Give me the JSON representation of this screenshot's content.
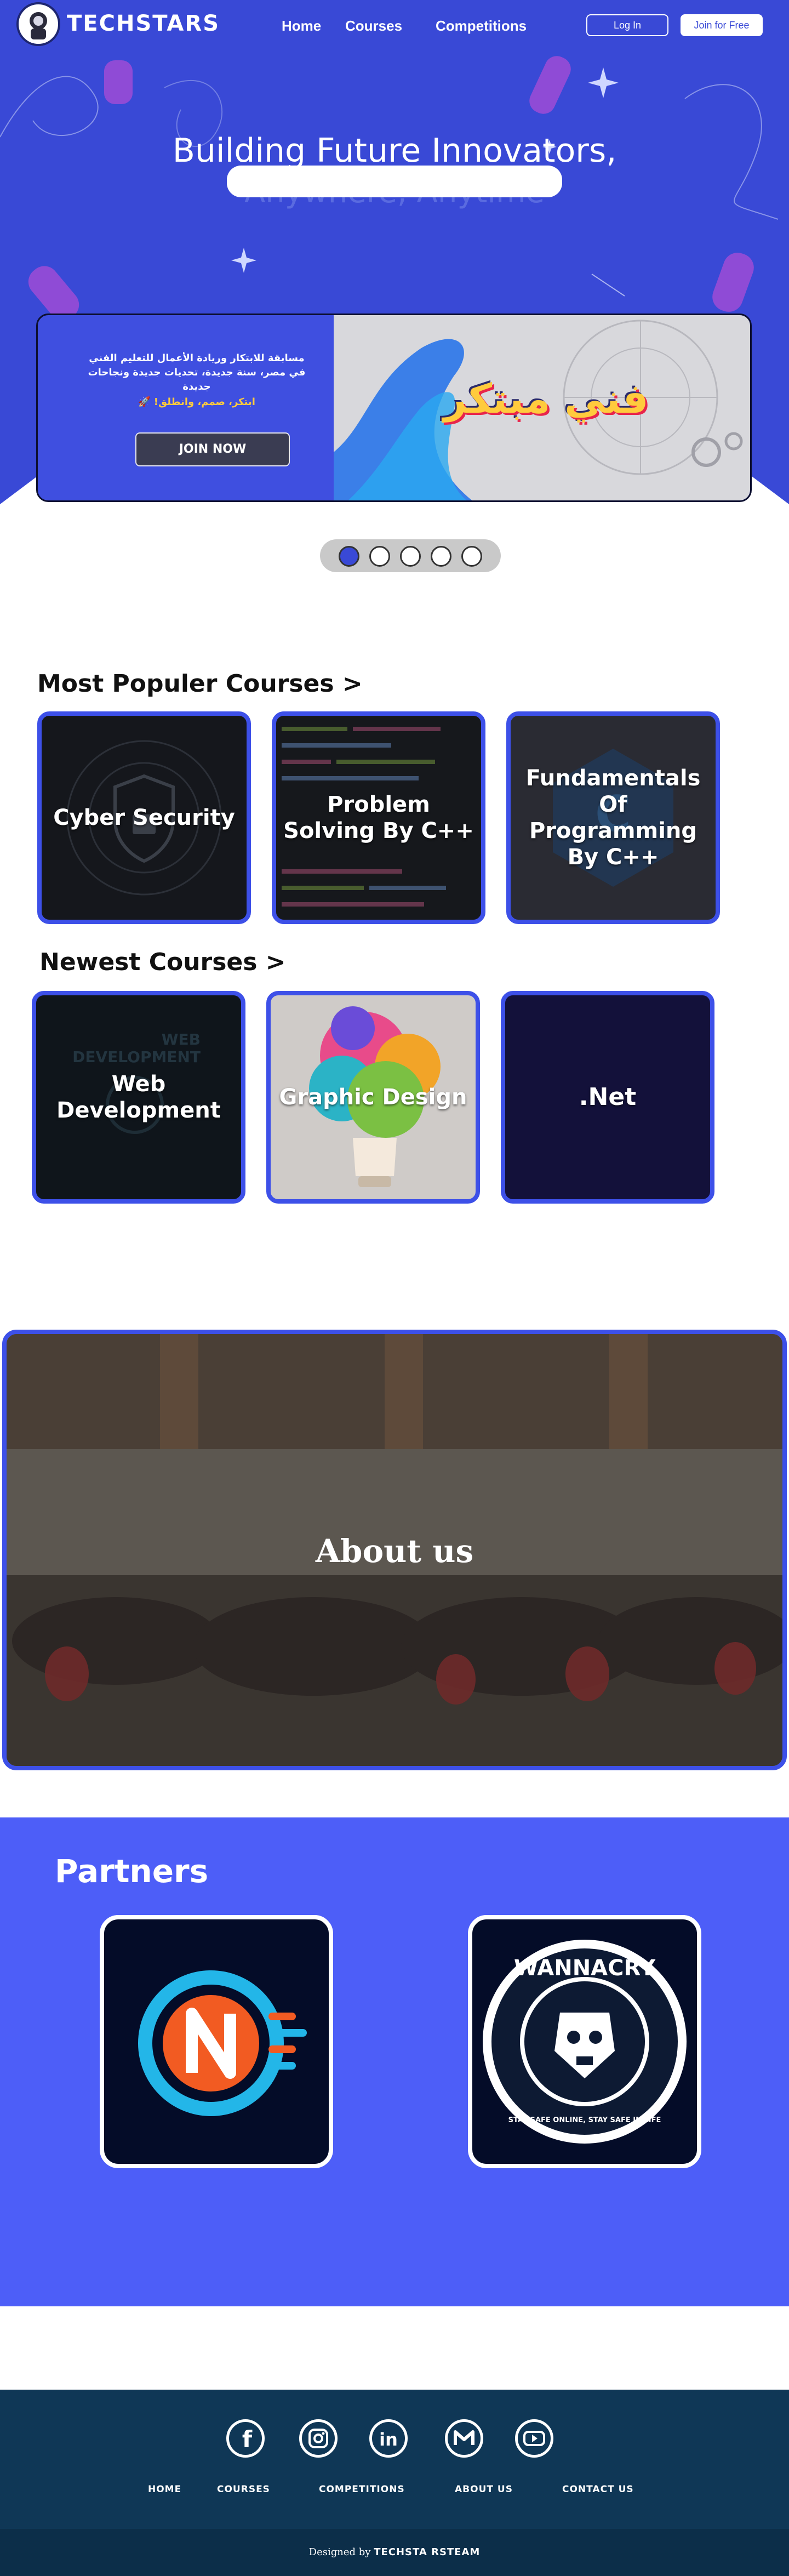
{
  "header": {
    "brand": "TECHSTARS",
    "nav": [
      "Home",
      "Courses",
      "Competitions"
    ],
    "login": "Log In",
    "join": "Join for Free"
  },
  "hero": {
    "title": "Building Future Innovators,",
    "subtitle": "Anywhere, Anytime"
  },
  "banner": {
    "line1": "مسابقة للابتكار وريادة الأعمال للتعليم الفني",
    "line2": "في مصر، سنة جديدة، تحديات جديدة ونجاحات جديدة",
    "slogan": "ابتكر، صمم، وانطلق! 🚀",
    "cta": "JOIN NOW",
    "logo": "فني مبتكر"
  },
  "slider": {
    "count": 5,
    "active": 0
  },
  "popular": {
    "title": "Most Populer Courses >",
    "courses": [
      "Cyber Security",
      "Problem Solving By C++",
      "Fundamentals Of Programming By C++"
    ]
  },
  "newest": {
    "title": "Newest Courses >",
    "courses": [
      "Web Development",
      "Graphic Design",
      ".Net"
    ]
  },
  "about": {
    "label": "About us"
  },
  "partners": {
    "title": "Partners",
    "items": [
      {
        "name": "N logo"
      },
      {
        "name": "WANNACRY",
        "ring_text": "STAY SAFE ONLINE, STAY SAFE IN LIFE"
      }
    ]
  },
  "footer": {
    "social": [
      "facebook-icon",
      "instagram-icon",
      "linkedin-icon",
      "gmail-icon",
      "youtube-icon"
    ],
    "links": [
      "HOME",
      "COURSES",
      "COMPETITIONS",
      "ABOUT US",
      "CONTACT US"
    ],
    "credit_prefix": "Designed by",
    "credit_name": "TECHSTA RSTEAM"
  },
  "colors": {
    "primary": "#3949d6",
    "accent": "#3d50e8",
    "footer": "#0f3756"
  }
}
